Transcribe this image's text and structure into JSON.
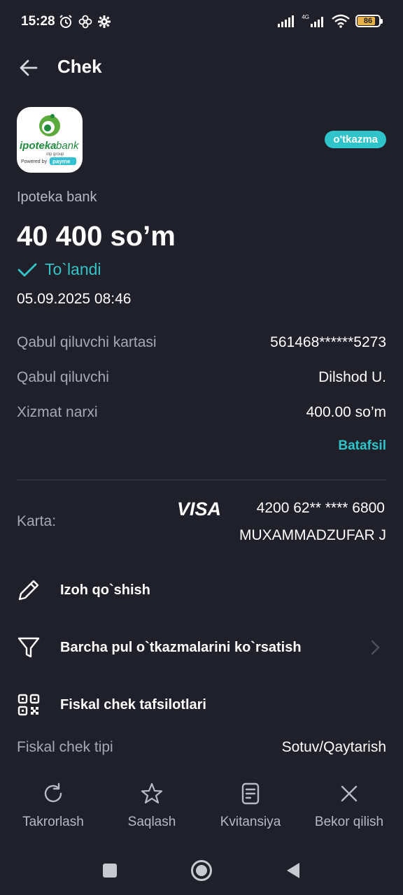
{
  "status_bar": {
    "time": "15:28",
    "battery": "86",
    "network": "4G"
  },
  "header": {
    "title": "Chek"
  },
  "logo": {
    "brand_text_1": "ipoteka",
    "brand_text_2": "bank",
    "sub_text": "otp group",
    "powered_by": "Powered by",
    "payme": "payme"
  },
  "receipt": {
    "type_badge": "o'tkazma",
    "merchant": "Ipoteka bank",
    "amount": "40 400 so’m",
    "status": "To`landi",
    "datetime": "05.09.2025 08:46",
    "status_color": "#34c3c7"
  },
  "details": [
    {
      "label": "Qabul qiluvchi kartasi",
      "value": "561468******5273"
    },
    {
      "label": "Qabul qiluvchi",
      "value": "Dilshod U."
    },
    {
      "label": "Xizmat narxi",
      "value": "400.00 so’m"
    }
  ],
  "more_link": "Batafsil",
  "card": {
    "label": "Karta:",
    "brand": "VISA",
    "number": "4200 62** **** 6800",
    "holder": "MUXAMMADZUFAR J"
  },
  "actions": [
    {
      "label": "Izoh qo`shish",
      "icon": "pencil-icon"
    },
    {
      "label": "Barcha pul o`tkazmalarini ko`rsatish",
      "icon": "filter-icon"
    },
    {
      "label": "Fiskal chek tafsilotlari",
      "icon": "qr-code-icon"
    }
  ],
  "fiscal": {
    "label": "Fiskal chek tipi",
    "value": "Sotuv/Qaytarish"
  },
  "bottom_actions": [
    {
      "label": "Takrorlash",
      "icon": "repeat-icon"
    },
    {
      "label": "Saqlash",
      "icon": "star-icon"
    },
    {
      "label": "Kvitansiya",
      "icon": "document-icon"
    },
    {
      "label": "Bekor qilish",
      "icon": "close-icon"
    }
  ],
  "colors": {
    "background": "#1f2029",
    "accent": "#2ec4c9",
    "muted_text": "#a7a9b3"
  }
}
